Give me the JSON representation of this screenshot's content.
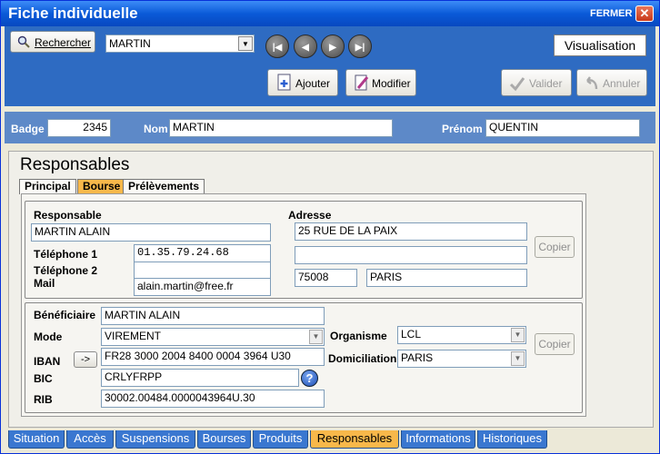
{
  "window": {
    "title": "Fiche individuelle",
    "close_label": "FERMER",
    "close_glyph": "✕"
  },
  "toolbar": {
    "search_label": "Rechercher",
    "selected_name": "MARTIN",
    "nav": {
      "first": "|◀",
      "prev": "◀",
      "next": "▶",
      "last": "▶|"
    },
    "mode": "Visualisation",
    "add_label": "Ajouter",
    "modify_label": "Modifier",
    "validate_label": "Valider",
    "cancel_label": "Annuler"
  },
  "header": {
    "badge_label": "Badge",
    "badge_value": "2345",
    "nom_label": "Nom",
    "nom_value": "MARTIN",
    "prenom_label": "Prénom",
    "prenom_value": "QUENTIN"
  },
  "section_title": "Responsables",
  "tabs": [
    {
      "label": "Principal",
      "active": false
    },
    {
      "label": "Bourse",
      "active": true
    },
    {
      "label": "Prélèvements",
      "active": false
    }
  ],
  "responsable": {
    "label": "Responsable",
    "value": "MARTIN ALAIN",
    "tel1_label": "Téléphone 1",
    "tel1_value": "01.35.79.24.68",
    "tel2_label": "Téléphone 2",
    "tel2_value": "",
    "mail_label": "Mail",
    "mail_value": "alain.martin@free.fr",
    "adresse_label": "Adresse",
    "adresse_line1": "25 RUE DE LA PAIX",
    "adresse_line2": "",
    "cp": "75008",
    "ville": "PARIS",
    "copier_label": "Copier"
  },
  "beneficiaire": {
    "label": "Bénéficiaire",
    "value": "MARTIN ALAIN",
    "mode_label": "Mode",
    "mode_value": "VIREMENT",
    "iban_label": "IBAN",
    "iban_btn": "->",
    "iban_value": "FR28 3000 2004 8400 0004 3964 U30",
    "bic_label": "BIC",
    "bic_value": "CRLYFRPP",
    "help_glyph": "?",
    "rib_label": "RIB",
    "rib_value": "30002.00484.0000043964U.30",
    "organisme_label": "Organisme",
    "organisme_value": "LCL",
    "domiciliation_label": "Domiciliation",
    "domiciliation_value": "PARIS",
    "copier_label": "Copier"
  },
  "bottom_tabs": [
    {
      "label": "Situation",
      "active": false
    },
    {
      "label": "Accès",
      "active": false
    },
    {
      "label": "Suspensions",
      "active": false
    },
    {
      "label": "Bourses",
      "active": false
    },
    {
      "label": "Produits",
      "active": false
    },
    {
      "label": "Responsables",
      "active": true
    },
    {
      "label": "Informations",
      "active": false
    },
    {
      "label": "Historiques",
      "active": false
    }
  ]
}
